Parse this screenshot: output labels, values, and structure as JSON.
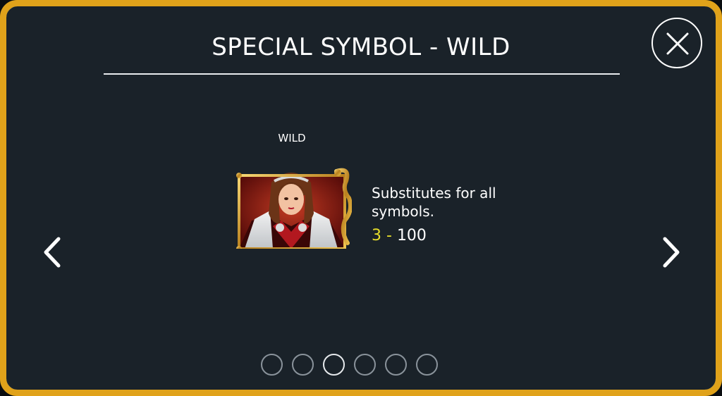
{
  "title": "SPECIAL SYMBOL - WILD",
  "symbol": {
    "label": "WILD",
    "image_description": "wild-character-portrait",
    "description": "Substitutes for all symbols.",
    "payout_count": "3 -",
    "payout_value": "100"
  },
  "pagination": {
    "total": 6,
    "active_index": 2
  },
  "colors": {
    "frame_gold": "#e0a21a",
    "background": "#1a2229",
    "count_yellow": "#e8df2a"
  },
  "icons": {
    "close": "close-icon",
    "prev": "chevron-left-icon",
    "next": "chevron-right-icon"
  }
}
